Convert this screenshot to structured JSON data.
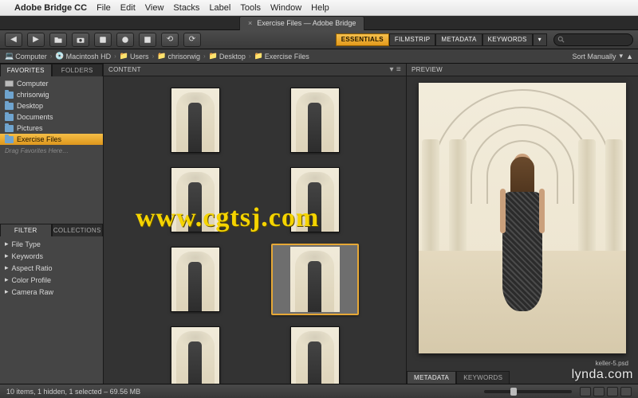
{
  "mac_menu": {
    "app_logo": "",
    "app_name": "Adobe Bridge CC",
    "items": [
      "File",
      "Edit",
      "View",
      "Stacks",
      "Label",
      "Tools",
      "Window",
      "Help"
    ]
  },
  "doc_tab": {
    "title": "Exercise Files — Adobe Bridge"
  },
  "workspaces": {
    "items": [
      "ESSENTIALS",
      "FILMSTRIP",
      "METADATA",
      "KEYWORDS"
    ],
    "active_index": 0
  },
  "sort": {
    "label": "Sort Manually",
    "dir_label": "▲"
  },
  "breadcrumb": [
    "Computer",
    "Macintosh HD",
    "Users",
    "chrisorwig",
    "Desktop",
    "Exercise Files"
  ],
  "favorites_panel": {
    "tabs": [
      "FAVORITES",
      "FOLDERS"
    ],
    "items": [
      {
        "label": "Computer",
        "icon": "comp"
      },
      {
        "label": "chrisorwig",
        "icon": "folder"
      },
      {
        "label": "Desktop",
        "icon": "folder"
      },
      {
        "label": "Documents",
        "icon": "folder"
      },
      {
        "label": "Pictures",
        "icon": "folder"
      },
      {
        "label": "Exercise Files",
        "icon": "folder",
        "selected": true
      }
    ],
    "drag_hint": "Drag Favorites Here…"
  },
  "filter_panel": {
    "tabs": [
      "FILTER",
      "COLLECTIONS"
    ],
    "items": [
      "File Type",
      "Keywords",
      "Aspect Ratio",
      "Color Profile",
      "Camera Raw"
    ]
  },
  "content_panel": {
    "title": "CONTENT"
  },
  "preview_panel": {
    "title": "PREVIEW",
    "caption": "keller-5.psd"
  },
  "meta_tabs": [
    "METADATA",
    "KEYWORDS"
  ],
  "statusbar": {
    "text": "10 items, 1 hidden, 1 selected – 69.56 MB"
  },
  "thumbnails": {
    "count": 8,
    "selected_index": 5
  },
  "watermark": "www.cgtsj.com",
  "corner_mark": "lynda.com"
}
